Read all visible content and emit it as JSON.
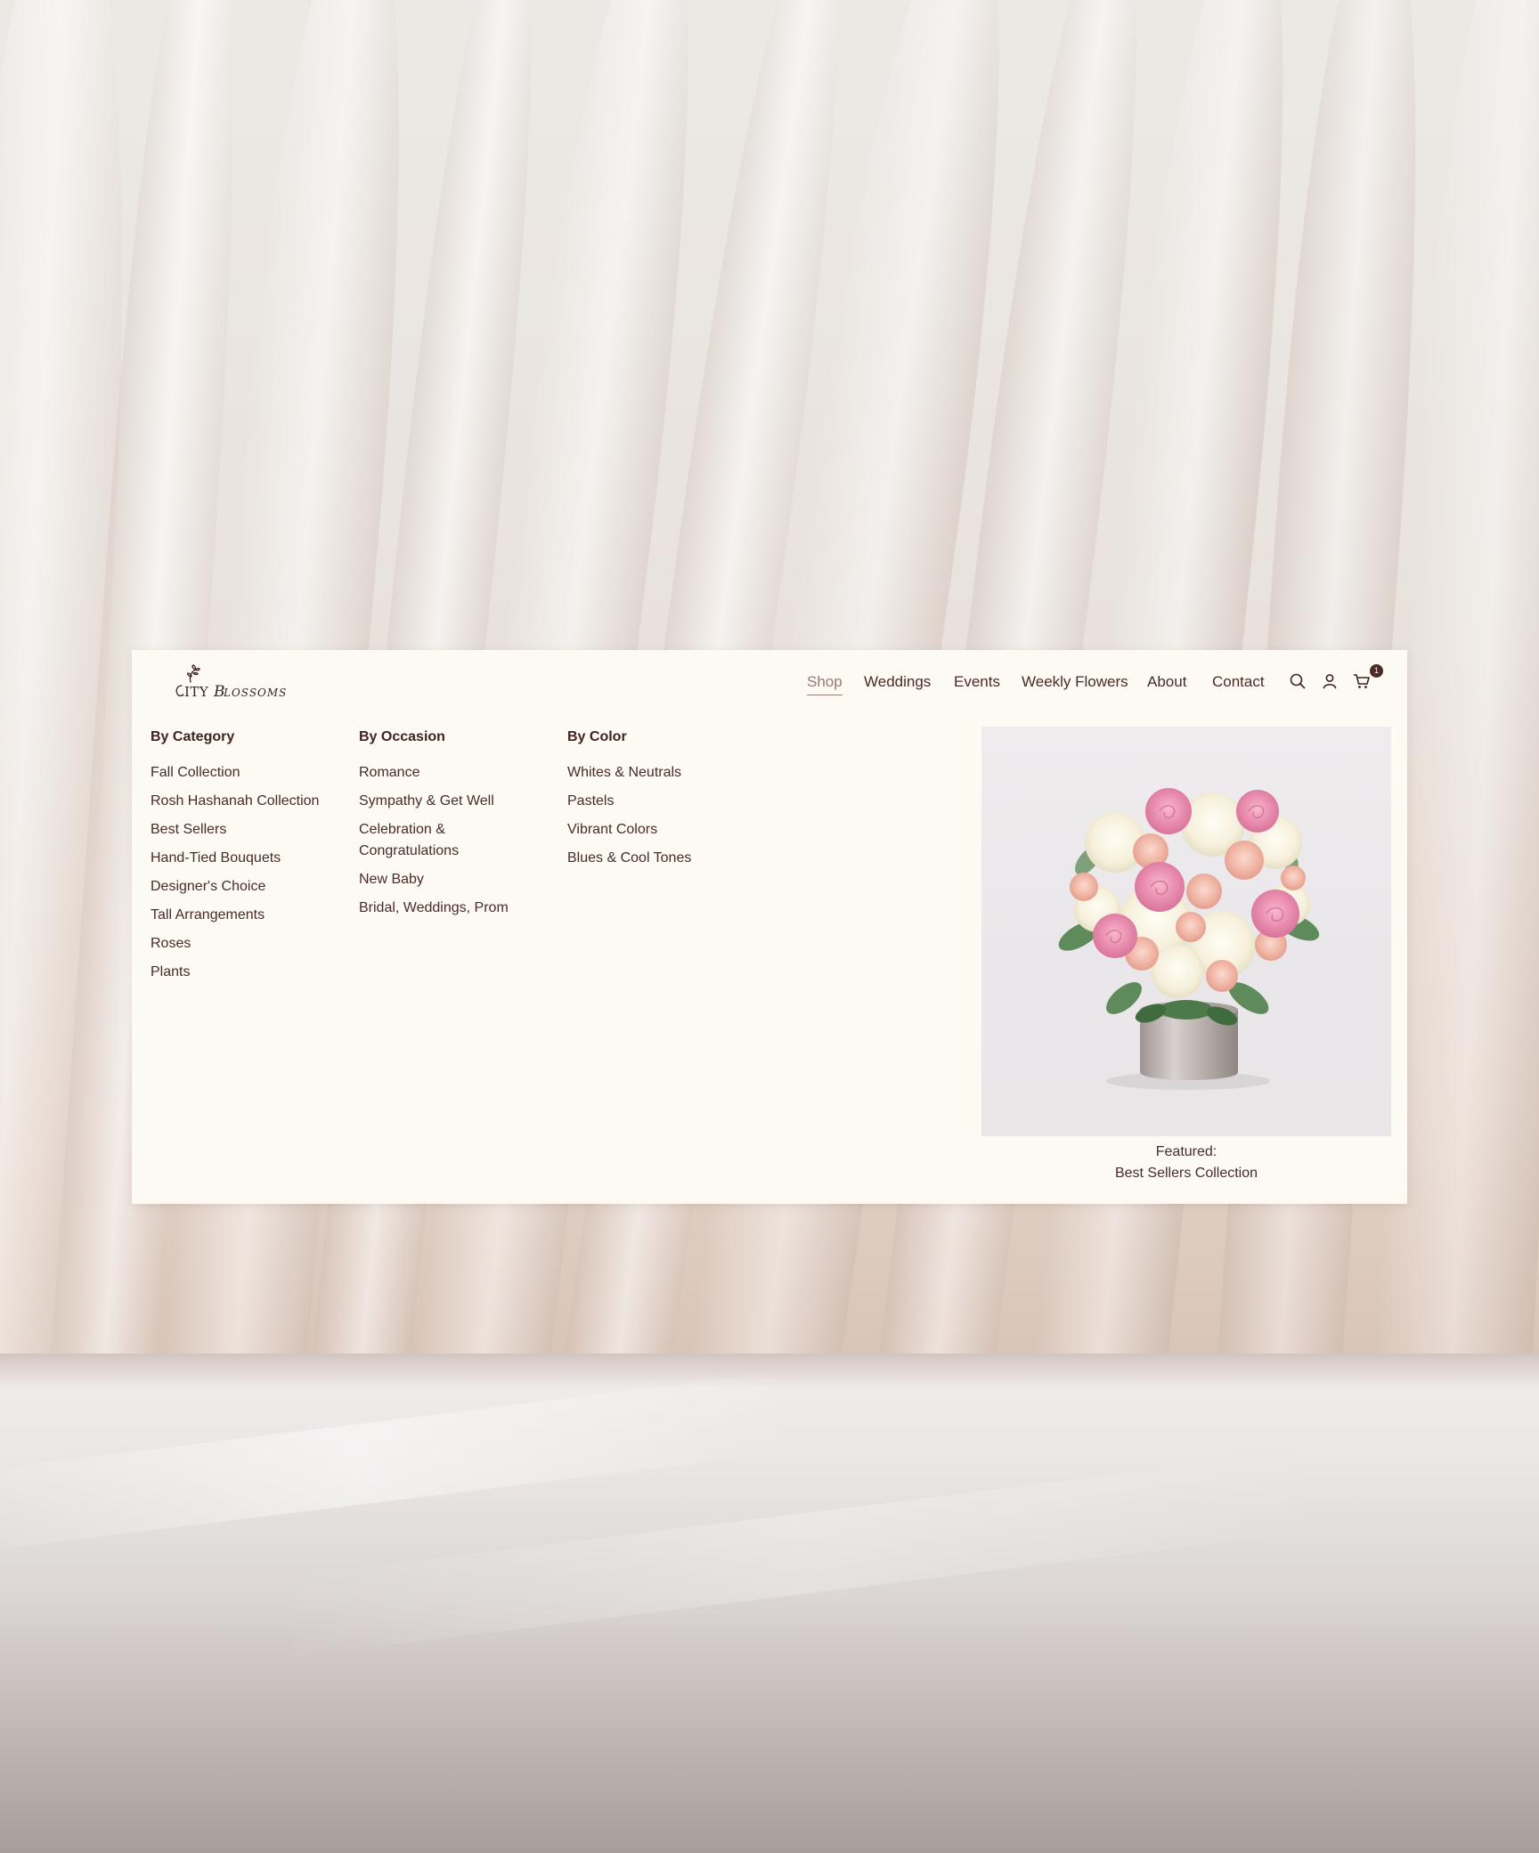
{
  "brand": {
    "name": "City Blossoms"
  },
  "nav": {
    "items": [
      {
        "label": "Shop",
        "active": true
      },
      {
        "label": "Weddings",
        "active": false
      },
      {
        "label": "Events",
        "active": false
      },
      {
        "label": "Weekly Flowers",
        "active": false
      },
      {
        "label": "About",
        "active": false
      },
      {
        "label": "Contact",
        "active": false
      }
    ],
    "icons": [
      "search-icon",
      "account-icon",
      "cart-icon"
    ],
    "cart_count": "1"
  },
  "menu": {
    "columns": [
      {
        "heading": "By Category",
        "items": [
          "Fall Collection",
          "Rosh Hashanah Collection",
          "Best Sellers",
          "Hand-Tied Bouquets",
          "Designer's Choice",
          "Tall Arrangements",
          "Roses",
          "Plants"
        ]
      },
      {
        "heading": "By Occasion",
        "items": [
          "Romance",
          "Sympathy & Get Well",
          "Celebration & Congratulations",
          "New Baby",
          "Bridal, Weddings, Prom"
        ]
      },
      {
        "heading": "By Color",
        "items": [
          "Whites & Neutrals",
          "Pastels",
          "Vibrant Colors",
          "Blues & Cool Tones"
        ]
      }
    ]
  },
  "featured": {
    "label": "Featured:",
    "title": "Best Sellers Collection"
  },
  "colors": {
    "text": "#4a2b26",
    "heading": "#3f231f",
    "active_nav": "#9a7a73",
    "card_bg": "#fdfaf4"
  }
}
